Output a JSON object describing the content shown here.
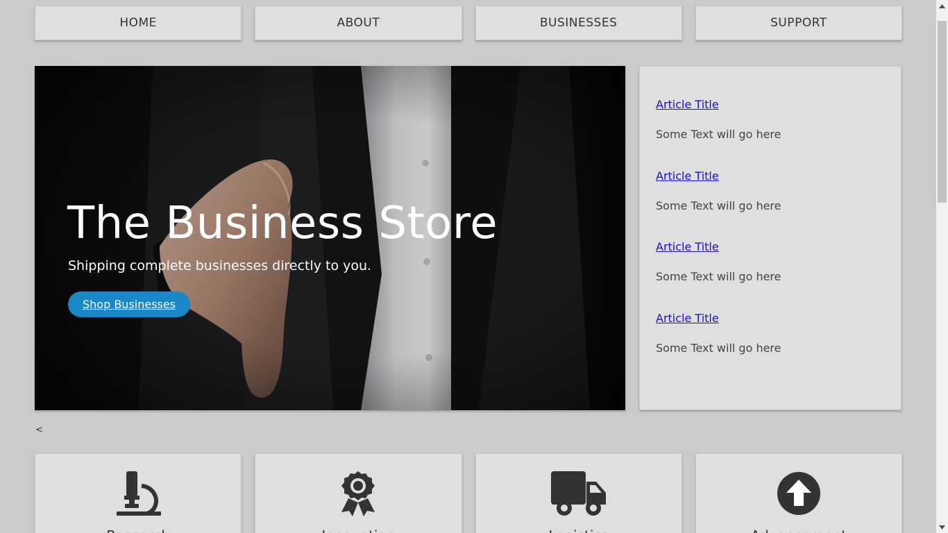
{
  "nav": {
    "items": [
      {
        "label": "HOME"
      },
      {
        "label": "ABOUT"
      },
      {
        "label": "BUSINESSES"
      },
      {
        "label": "SUPPORT"
      }
    ]
  },
  "hero": {
    "title": "The Business Store",
    "subtitle": "Shipping complete businesses directly to you.",
    "button_label": "Shop Businesses",
    "image": "handshake-businessman-photo"
  },
  "articles": [
    {
      "title": "Article Title",
      "text": "Some Text will go here"
    },
    {
      "title": "Article Title",
      "text": "Some Text will go here"
    },
    {
      "title": "Article Title",
      "text": "Some Text will go here"
    },
    {
      "title": "Article Title",
      "text": "Some Text will go here"
    }
  ],
  "carousel": {
    "prev_label": "<"
  },
  "features": [
    {
      "icon": "microscope-icon",
      "label": "Research"
    },
    {
      "icon": "award-ribbon-icon",
      "label": "Innovation"
    },
    {
      "icon": "truck-icon",
      "label": "Logistics"
    },
    {
      "icon": "arrow-up-circle-icon",
      "label": "Advancement"
    }
  ],
  "colors": {
    "page_bg": "#cbcbcb",
    "panel_bg": "#dfdfdf",
    "accent": "#1a87c7",
    "link": "#1a0dcc",
    "icon": "#333333"
  }
}
